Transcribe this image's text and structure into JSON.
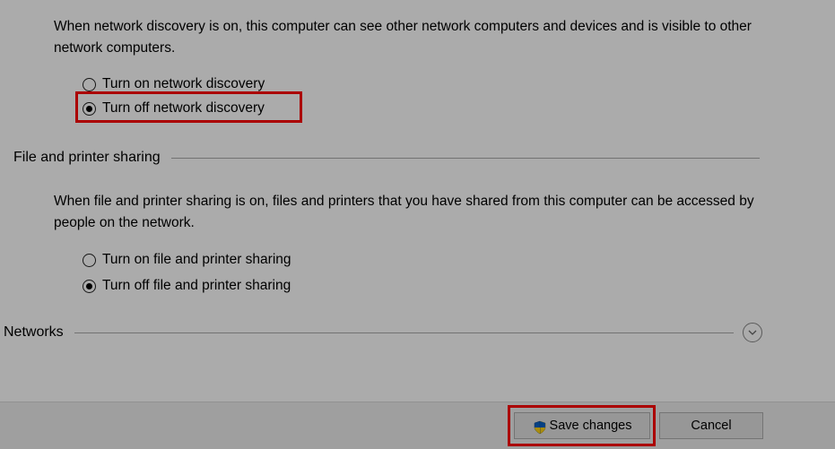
{
  "network_discovery": {
    "description": "When network discovery is on, this computer can see other network computers and devices and is visible to other network computers.",
    "option_on": "Turn on network discovery",
    "option_off": "Turn off network discovery"
  },
  "file_printer_sharing": {
    "header": "File and printer sharing",
    "description": "When file and printer sharing is on, files and printers that you have shared from this computer can be accessed by people on the network.",
    "option_on": "Turn on file and printer sharing",
    "option_off": "Turn off file and printer sharing"
  },
  "networks": {
    "header": "Networks"
  },
  "buttons": {
    "save": "Save changes",
    "cancel": "Cancel"
  }
}
